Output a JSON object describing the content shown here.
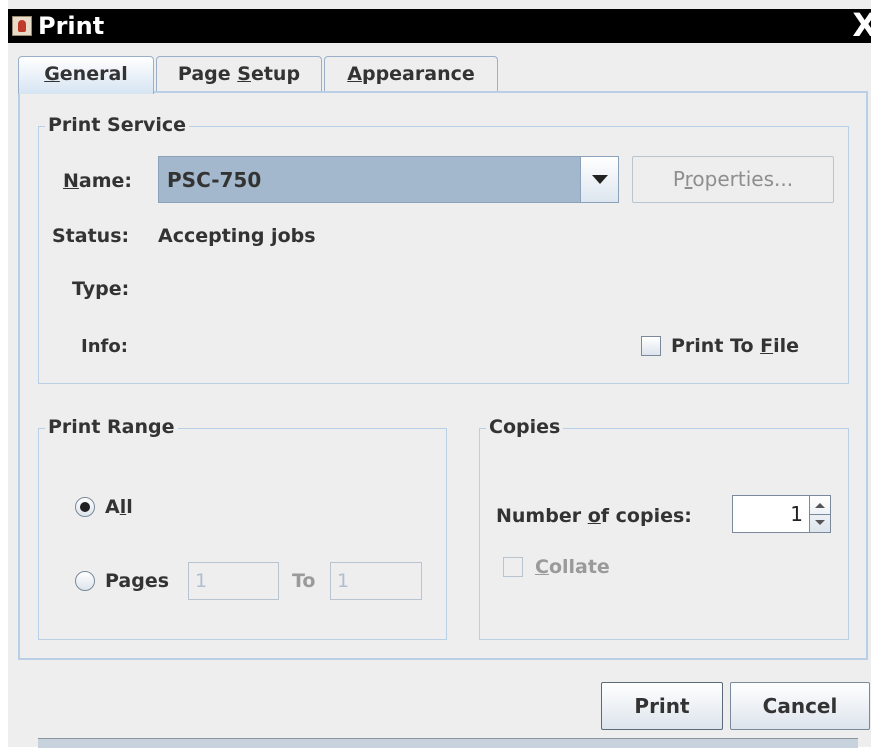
{
  "window": {
    "title": "Print",
    "close_glyph": "X"
  },
  "tabs": [
    {
      "pre": "",
      "key": "G",
      "post": "eneral",
      "active": true
    },
    {
      "pre": "Page ",
      "key": "S",
      "post": "etup",
      "active": false
    },
    {
      "pre": "",
      "key": "A",
      "post": "ppearance",
      "active": false
    }
  ],
  "print_service": {
    "legend": "Print Service",
    "name_label_key": "N",
    "name_label_rest": "ame:",
    "selected_printer": "PSC-750",
    "properties_pre": "P",
    "properties_key": "r",
    "properties_post": "operties...",
    "status_label": "Status:",
    "status_value": "Accepting jobs",
    "type_label": "Type:",
    "type_value": "",
    "info_label": "Info:",
    "info_value": "",
    "print_to_file_pre": "Print To ",
    "print_to_file_key": "F",
    "print_to_file_post": "ile",
    "print_to_file_checked": false
  },
  "print_range": {
    "legend": "Print Range",
    "all_pre": "A",
    "all_key": "l",
    "all_post": "l",
    "all_selected": true,
    "pages_pre": "Pa",
    "pages_key": "g",
    "pages_post": "es",
    "from_value": "1",
    "to_label": "To",
    "to_value": "1"
  },
  "copies": {
    "legend": "Copies",
    "number_pre": "Number ",
    "number_key": "o",
    "number_post": "f copies:",
    "count": "1",
    "collate_key": "C",
    "collate_post": "ollate",
    "collate_checked": false
  },
  "buttons": {
    "print": "Print",
    "cancel": "Cancel"
  },
  "colors": {
    "titlebar": "#000000",
    "panel_border": "#b8cfe5",
    "combo_selected": "#a3b8cc",
    "background": "#eeeeee"
  }
}
